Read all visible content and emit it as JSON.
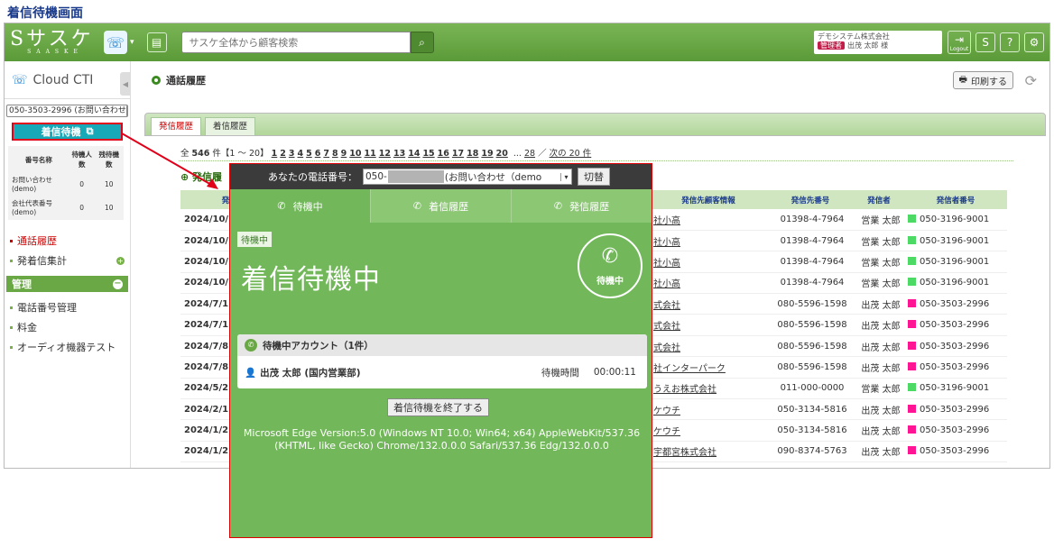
{
  "caption": "着信待機画面",
  "topbar": {
    "logo_text": "Sサスケ",
    "logo_sub": "SAASKE",
    "search_placeholder": "サスケ全体から顧客検索",
    "company": "デモシステム株式会社",
    "role": "管理者",
    "user": "出茂 太郎 様",
    "logout": "Logout",
    "help": "?"
  },
  "sidebar": {
    "title": "Cloud CTI",
    "number_select": "050-3503-2996 (お問い合わせ",
    "standby_button": "着信待機",
    "status_table": {
      "headers": [
        "番号名称",
        "待機人数",
        "残待機数"
      ],
      "rows": [
        [
          "お問い合わせ(demo)",
          "0",
          "10"
        ],
        [
          "会社代表番号(demo)",
          "0",
          "10"
        ]
      ]
    },
    "nav": [
      {
        "label": "通話履歴",
        "active": true
      },
      {
        "label": "発着信集計",
        "active": false
      }
    ],
    "mgmt_title": "管理",
    "mgmt_items": [
      "電話番号管理",
      "料金",
      "オーディオ機器テスト"
    ]
  },
  "main": {
    "title": "通話履歴",
    "print": "印刷する",
    "tabs": [
      "発信履歴",
      "着信履歴"
    ],
    "pager": {
      "total": "全",
      "count": "546",
      "unit": "件【1 ～ 20】",
      "pages": [
        "1",
        "2",
        "3",
        "4",
        "5",
        "6",
        "7",
        "8",
        "9",
        "10",
        "11",
        "12",
        "13",
        "14",
        "15",
        "16",
        "17",
        "18",
        "19",
        "20"
      ],
      "ellipsis": "...",
      "last": "28",
      "sep": "／",
      "next": "次の 20 件"
    },
    "sub_title": "発信履",
    "columns": [
      "発",
      "発信先顧客情報",
      "発信先番号",
      "発信者",
      "発信者番号"
    ],
    "rows": [
      [
        "2024/10/",
        "社小高",
        "01398-4-7964",
        "営業 太郎",
        "050-3196-9001",
        "#4cd964"
      ],
      [
        "2024/10/",
        "社小高",
        "01398-4-7964",
        "営業 太郎",
        "050-3196-9001",
        "#4cd964"
      ],
      [
        "2024/10/",
        "社小高",
        "01398-4-7964",
        "営業 太郎",
        "050-3196-9001",
        "#4cd964"
      ],
      [
        "2024/10/",
        "社小高",
        "01398-4-7964",
        "営業 太郎",
        "050-3196-9001",
        "#4cd964"
      ],
      [
        "2024/7/1",
        "式会社",
        "080-5596-1598",
        "出茂 太郎",
        "050-3503-2996",
        "#ff1493"
      ],
      [
        "2024/7/1",
        "式会社",
        "080-5596-1598",
        "出茂 太郎",
        "050-3503-2996",
        "#ff1493"
      ],
      [
        "2024/7/8",
        "式会社",
        "080-5596-1598",
        "出茂 太郎",
        "050-3503-2996",
        "#ff1493"
      ],
      [
        "2024/7/8",
        "社インターパーク",
        "080-5596-1598",
        "出茂 太郎",
        "050-3503-2996",
        "#ff1493"
      ],
      [
        "2024/5/2",
        "うえお株式会社",
        "011-000-0000",
        "営業 太郎",
        "050-3196-9001",
        "#4cd964"
      ],
      [
        "2024/2/1",
        "ケウチ",
        "050-3134-5816",
        "出茂 太郎",
        "050-3503-2996",
        "#ff1493"
      ],
      [
        "2024/1/2",
        "ケウチ",
        "050-3134-5816",
        "出茂 太郎",
        "050-3503-2996",
        "#ff1493"
      ],
      [
        "2024/1/2",
        "宇都宮株式会社",
        "090-8374-5763",
        "出茂 太郎",
        "050-3503-2996",
        "#ff1493"
      ]
    ]
  },
  "overlay": {
    "phone_label": "あなたの電話番号：",
    "phone_prefix": "050-",
    "phone_suffix": "(お問い合わせ（demo",
    "switch": "切替",
    "tabs": [
      "待機中",
      "着信履歴",
      "発信履歴"
    ],
    "status_label": "待機中",
    "big_status": "着信待機中",
    "circle_label": "待機中",
    "account_header": "待機中アカウント（1件）",
    "account_name": "出茂 太郎 (国内営業部)",
    "wait_label": "待機時間",
    "wait_time": "00:00:11",
    "end_button": "着信待機を終了する",
    "user_agent": "Microsoft Edge Version:5.0 (Windows NT 10.0; Win64; x64) AppleWebKit/537.36 (KHTML, like Gecko) Chrome/132.0.0.0 Safari/537.36 Edg/132.0.0.0"
  }
}
